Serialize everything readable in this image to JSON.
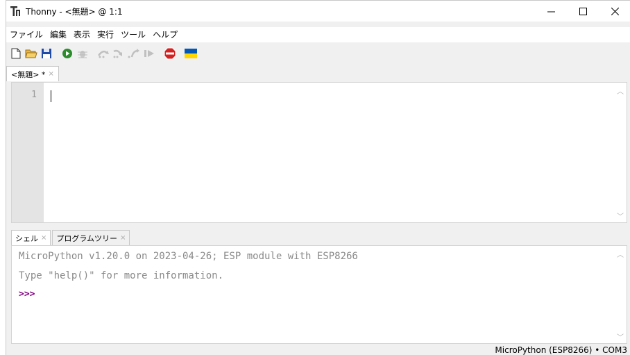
{
  "window": {
    "title": "Thonny - <無題> @ 1:1"
  },
  "menu": {
    "items": [
      {
        "label": "ファイル"
      },
      {
        "label": "編集"
      },
      {
        "label": "表示"
      },
      {
        "label": "実行"
      },
      {
        "label": "ツール"
      },
      {
        "label": "ヘルプ"
      }
    ]
  },
  "toolbar": {
    "icons": [
      "new-file-icon",
      "open-folder-icon",
      "save-icon",
      "run-icon",
      "debug-icon",
      "step-over-icon",
      "step-into-icon",
      "step-out-icon",
      "resume-icon",
      "stop-icon",
      "ukraine-flag-icon"
    ]
  },
  "editor": {
    "tab_label": "<無題> *",
    "tab_close": "×",
    "line_number": "1"
  },
  "shell_tabs": [
    {
      "label": "シェル",
      "close": "×"
    },
    {
      "label": "プログラムツリー",
      "close": "×"
    }
  ],
  "shell": {
    "line1": "MicroPython v1.20.0 on 2023-04-26; ESP module with ESP8266",
    "line2": "Type \"help()\" for more information.",
    "prompt": ">>>"
  },
  "status": {
    "text": "MicroPython (ESP8266) • COM3"
  },
  "colors": {
    "prompt": "#800080",
    "shell_text": "#8a8a8a",
    "gutter": "#e4e4e4",
    "run_green": "#2e8b2e",
    "stop_red": "#d42222",
    "flag_blue": "#0057b7",
    "flag_yellow": "#ffd700"
  }
}
